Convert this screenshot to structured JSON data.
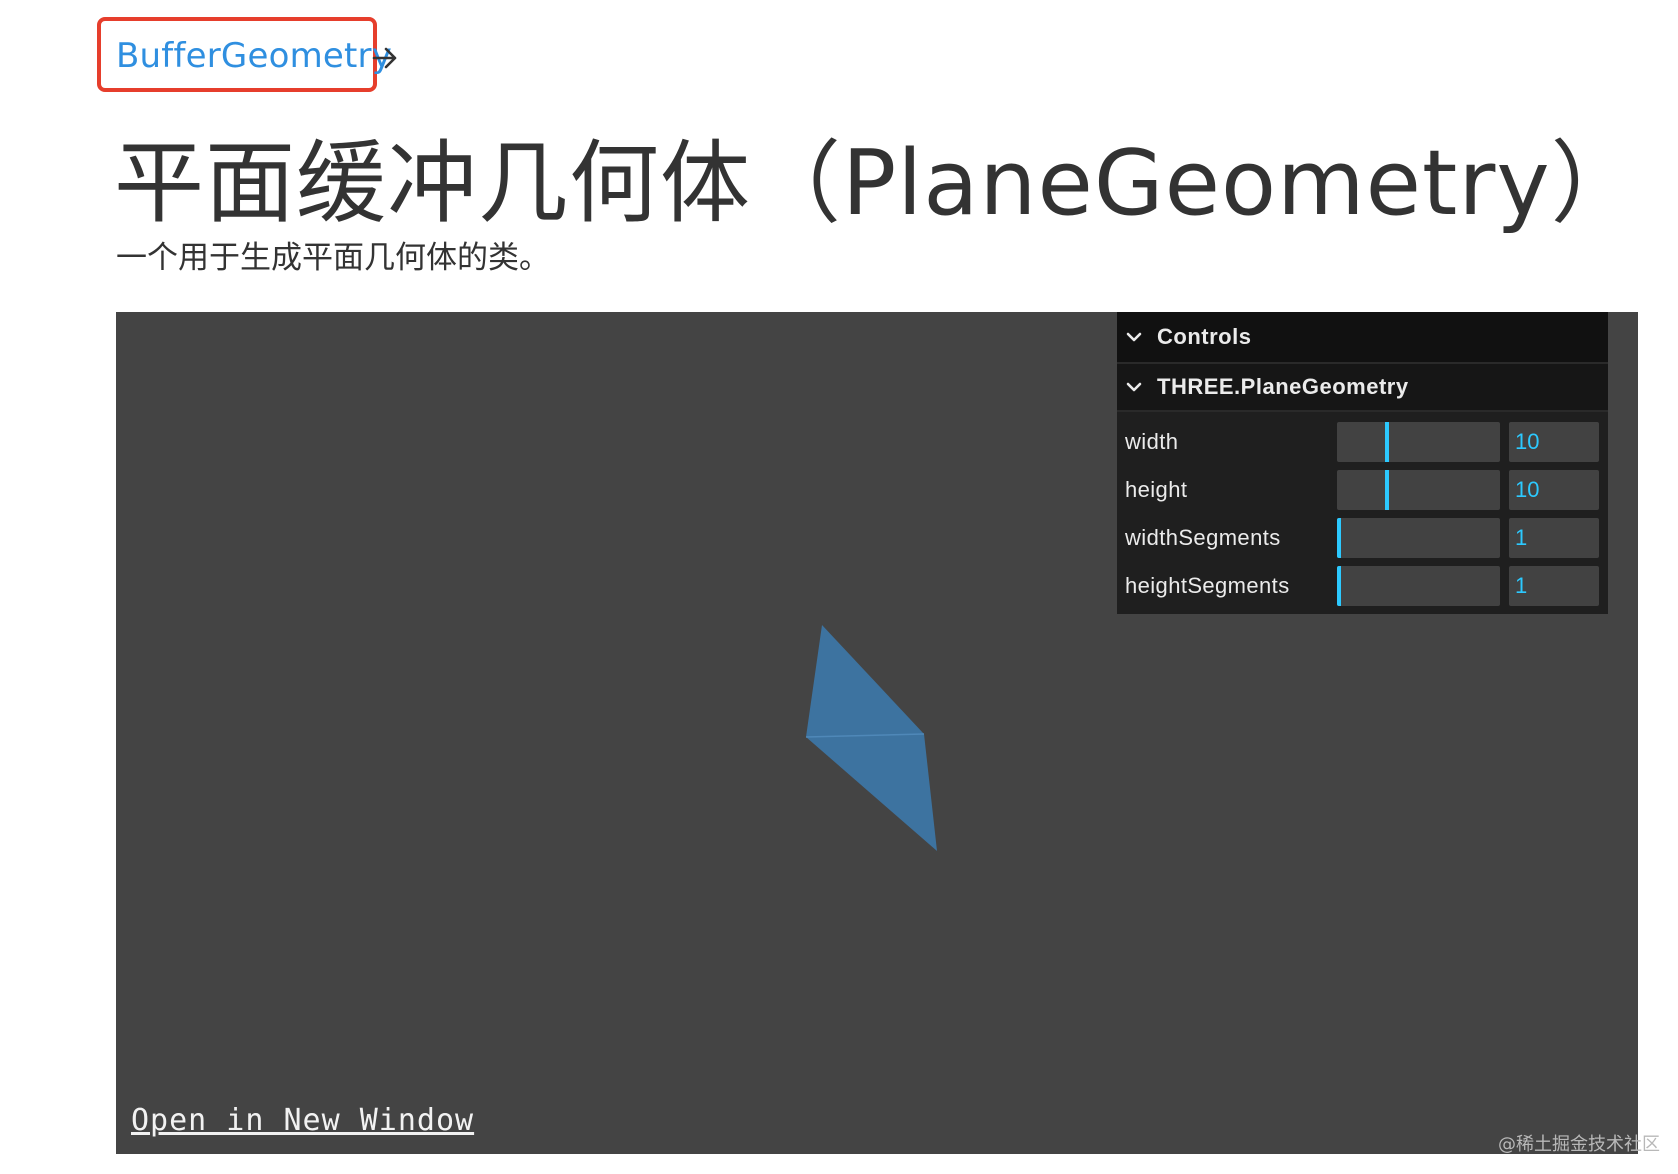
{
  "header": {
    "parent_link": "BufferGeometry",
    "title": "平面缓冲几何体（PlaneGeometry）",
    "description": "一个用于生成平面几何体的类。"
  },
  "viewport": {
    "open_link": "Open in New Window",
    "mesh_color": "#3d73a0",
    "background": "#444444"
  },
  "gui": {
    "title": "Controls",
    "folder": "THREE.PlaneGeometry",
    "params": [
      {
        "label": "width",
        "value": "10",
        "fraction": 0.3
      },
      {
        "label": "height",
        "value": "10",
        "fraction": 0.3
      },
      {
        "label": "widthSegments",
        "value": "1",
        "fraction": 0.0
      },
      {
        "label": "heightSegments",
        "value": "1",
        "fraction": 0.0
      }
    ],
    "accent": "#2cc9ff"
  },
  "watermark": "@稀土掘金技术社区"
}
